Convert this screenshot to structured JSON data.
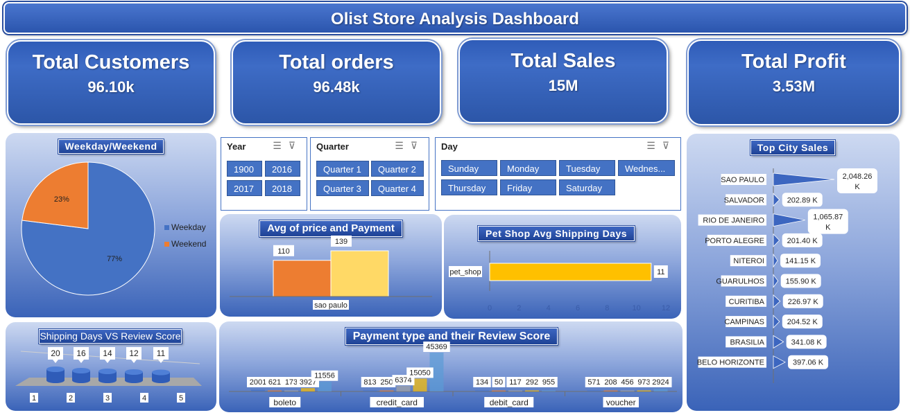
{
  "header": {
    "title": "Olist Store Analysis Dashboard"
  },
  "kpis": [
    {
      "label": "Total Customers",
      "value": "96.10k"
    },
    {
      "label": "Total orders",
      "value": "96.48k"
    },
    {
      "label": "Total Sales",
      "value": "15M"
    },
    {
      "label": "Total Profit",
      "value": "3.53M"
    }
  ],
  "slicers": {
    "year": {
      "label": "Year",
      "items": [
        "1900",
        "2016",
        "2017",
        "2018"
      ]
    },
    "quarter": {
      "label": "Quarter",
      "items": [
        "Quarter 1",
        "Quarter 2",
        "Quarter 3",
        "Quarter 4"
      ]
    },
    "day": {
      "label": "Day",
      "items": [
        "Sunday",
        "Monday",
        "Tuesday",
        "Wednes...",
        "Thursday",
        "Friday",
        "Saturday"
      ]
    },
    "icons": [
      "multi-select-icon",
      "clear-filter-icon"
    ]
  },
  "colors": {
    "blue": "#4472c4",
    "orange": "#ed7d31",
    "yellow": "#ffd966",
    "gold": "#ffc000",
    "navy": "#1f3f8f"
  },
  "chart_data": [
    {
      "id": "weekday_weekend",
      "type": "pie",
      "title": "Weekday/Weekend",
      "labels": [
        "Weekday",
        "Weekend"
      ],
      "values": [
        77,
        23
      ],
      "data_labels": [
        "77%",
        "23%"
      ],
      "legend": "right"
    },
    {
      "id": "avg_price_payment",
      "type": "bar",
      "title": "Avg of price and Payment",
      "categories": [
        "sao paulo"
      ],
      "series": [
        {
          "values": [
            110
          ]
        },
        {
          "values": [
            139
          ]
        }
      ]
    },
    {
      "id": "pet_shop_shipping",
      "type": "bar",
      "orientation": "horizontal",
      "title": "Pet Shop Avg Shipping Days",
      "categories": [
        "pet_shop"
      ],
      "values": [
        11
      ],
      "xticks": [
        "0",
        "2",
        "4",
        "6",
        "8",
        "10",
        "12"
      ],
      "xlim": [
        0,
        12
      ]
    },
    {
      "id": "top_city_sales",
      "type": "bar",
      "orientation": "horizontal",
      "title": "Top City Sales",
      "categories": [
        "SAO PAULO",
        "SALVADOR",
        "RIO DE JANEIRO",
        "PORTO ALEGRE",
        "NITEROI",
        "GUARULHOS",
        "CURITIBA",
        "CAMPINAS",
        "BRASILIA",
        "BELO HORIZONTE"
      ],
      "values": [
        2048.26,
        202.89,
        1065.87,
        201.4,
        141.15,
        155.9,
        226.97,
        204.52,
        341.08,
        397.06
      ],
      "data_labels": [
        "2,048.26 K",
        "202.89 K",
        "1,065.87 K",
        "201.40 K",
        "141.15 K",
        "155.90 K",
        "226.97 K",
        "204.52 K",
        "341.08 K",
        "397.06 K"
      ]
    },
    {
      "id": "shipping_vs_review",
      "type": "bar",
      "title": "Shipping Days VS Review Score",
      "categories": [
        "1",
        "2",
        "3",
        "4",
        "5"
      ],
      "values": [
        20,
        16,
        14,
        12,
        11
      ]
    },
    {
      "id": "payment_review",
      "type": "bar",
      "title": "Payment type and their Review Score",
      "categories": [
        "boleto",
        "credit_card",
        "debit_card",
        "voucher"
      ],
      "groups": [
        {
          "labels": [
            "2001",
            "621",
            "173",
            "3927",
            "11556"
          ],
          "values": [
            2001,
            621,
            173,
            3927,
            11556
          ]
        },
        {
          "labels": [
            "813",
            "250",
            "6374",
            "15050",
            "45369"
          ],
          "values": [
            813,
            250,
            6374,
            15050,
            45369
          ]
        },
        {
          "labels": [
            "134",
            "50",
            "117",
            "292",
            "955"
          ],
          "values": [
            134,
            50,
            117,
            292,
            955
          ]
        },
        {
          "labels": [
            "571",
            "208",
            "456",
            "973",
            "2924"
          ],
          "values": [
            571,
            208,
            456,
            973,
            2924
          ]
        }
      ],
      "display_labels": [
        [
          "2001",
          "621",
          "173",
          "3927",
          "11556"
        ],
        [
          "813",
          "250",
          "6374",
          "15050",
          "45369"
        ],
        [
          "134",
          "50",
          "117",
          "292",
          "955"
        ],
        [
          "571",
          "208",
          "456",
          "973",
          "2924"
        ]
      ]
    }
  ]
}
